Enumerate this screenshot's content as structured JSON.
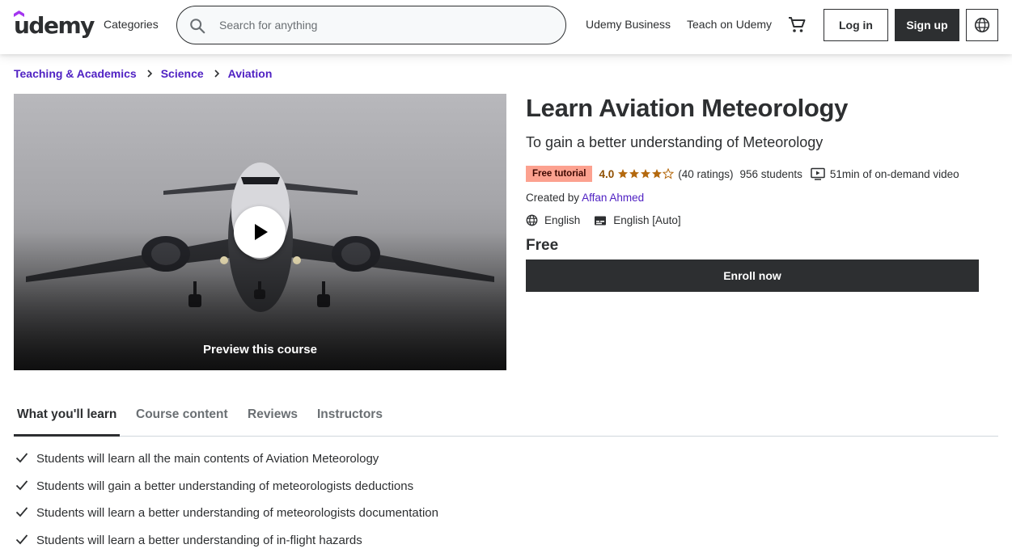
{
  "header": {
    "logo_text": "udemy",
    "categories_label": "Categories",
    "search_placeholder": "Search for anything",
    "business_link": "Udemy Business",
    "teach_link": "Teach on Udemy",
    "login_label": "Log in",
    "signup_label": "Sign up",
    "icons": [
      "search-icon",
      "cart-icon",
      "globe-icon"
    ]
  },
  "breadcrumb": [
    "Teaching & Academics",
    "Science",
    "Aviation"
  ],
  "preview": {
    "label": "Preview this course"
  },
  "course": {
    "title": "Learn Aviation Meteorology",
    "subtitle": "To gain a better understanding of Meteorology",
    "badge": "Free tutorial",
    "rating_value": "4.0",
    "rating_stars": 4,
    "ratings_count": "(40 ratings)",
    "students": "956 students",
    "video_length": "51min of on-demand video",
    "created_by_label": "Created by",
    "instructor": "Affan Ahmed",
    "language": "English",
    "captions": "English [Auto]",
    "price": "Free",
    "enroll_label": "Enroll now"
  },
  "tabs": [
    {
      "label": "What you'll learn",
      "active": true
    },
    {
      "label": "Course content",
      "active": false
    },
    {
      "label": "Reviews",
      "active": false
    },
    {
      "label": "Instructors",
      "active": false
    }
  ],
  "learn_items": [
    "Students will learn all the main contents of Aviation Meteorology",
    "Students will gain a better understanding of meteorologists deductions",
    "Students will learn a better understanding of meteorologists documentation",
    "Students will learn a better understanding of in-flight hazards"
  ],
  "colors": {
    "brand_purple": "#a435f0",
    "link_purple": "#5022c3",
    "text_dark": "#2d2f31",
    "star_orange": "#b4690e",
    "badge_bg": "#fca18f"
  }
}
